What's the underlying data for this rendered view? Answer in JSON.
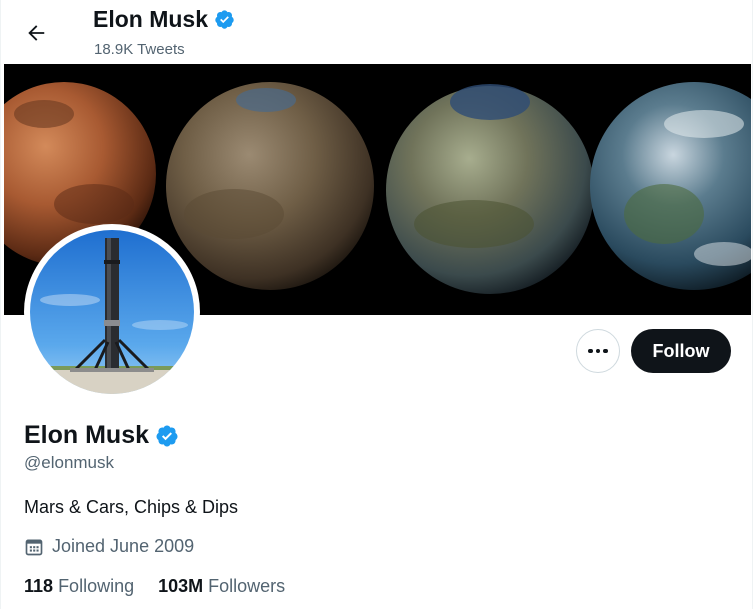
{
  "header": {
    "back_icon": "arrow-left-icon",
    "title": "Elon Musk",
    "tweet_count": "18.9K Tweets"
  },
  "profile": {
    "name": "Elon Musk",
    "handle": "@elonmusk",
    "bio": "Mars & Cars, Chips & Dips",
    "joined": "Joined June 2009",
    "verified_icon": "verified-badge-icon",
    "calendar_icon": "calendar-icon"
  },
  "actions": {
    "more_icon": "more-options-icon",
    "follow_label": "Follow"
  },
  "stats": {
    "following_count": "118",
    "following_label": "Following",
    "followers_count": "103M",
    "followers_label": "Followers"
  },
  "colors": {
    "verified": "#1d9bf0",
    "text_primary": "#0f1419",
    "text_secondary": "#536471",
    "follow_bg": "#0f1419"
  }
}
